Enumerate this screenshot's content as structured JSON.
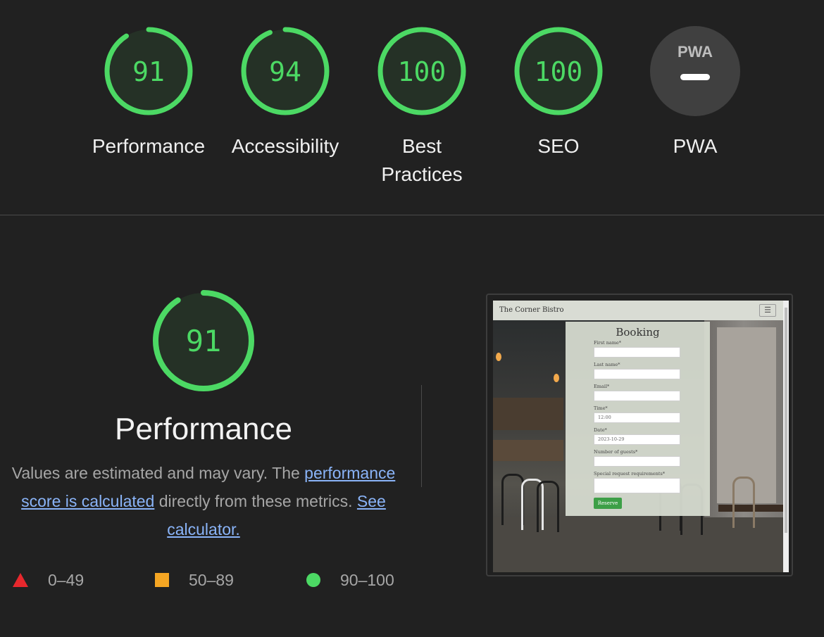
{
  "colors": {
    "pass": "#4cd964",
    "average": "#f5a623",
    "fail": "#e7282d",
    "link": "#8ab4f8"
  },
  "gauges": [
    {
      "score": "91",
      "score_value": 91,
      "label": "Performance"
    },
    {
      "score": "94",
      "score_value": 94,
      "label": "Accessibility"
    },
    {
      "score": "100",
      "score_value": 100,
      "label": "Best Practices"
    },
    {
      "score": "100",
      "score_value": 100,
      "label": "SEO"
    },
    {
      "score": "",
      "label": "PWA",
      "badge": "PWA",
      "icon": "pwa-icon"
    }
  ],
  "performance": {
    "score": "91",
    "score_value": 91,
    "title": "Performance",
    "desc_prefix": "Values are estimated and may vary. The",
    "link_score": "performance score is calculated",
    "desc_middle": "directly from these metrics.",
    "link_calculator": "See calculator."
  },
  "legend": [
    {
      "range": "0–49",
      "icon": "triangle-icon"
    },
    {
      "range": "50–89",
      "icon": "square-icon"
    },
    {
      "range": "90–100",
      "icon": "circle-icon"
    }
  ],
  "screenshot": {
    "site_name": "The Corner Bistro",
    "menu_icon": "☰",
    "form_title": "Booking",
    "fields": [
      {
        "label": "First name*",
        "value": ""
      },
      {
        "label": "Last name*",
        "value": ""
      },
      {
        "label": "Email*",
        "value": ""
      },
      {
        "label": "Time*",
        "value": "12:00"
      },
      {
        "label": "Date*",
        "value": "2023-10-29"
      },
      {
        "label": "Number of guests*",
        "value": ""
      },
      {
        "label": "Special request requirements*",
        "value": ""
      }
    ],
    "button": "Reserve"
  }
}
